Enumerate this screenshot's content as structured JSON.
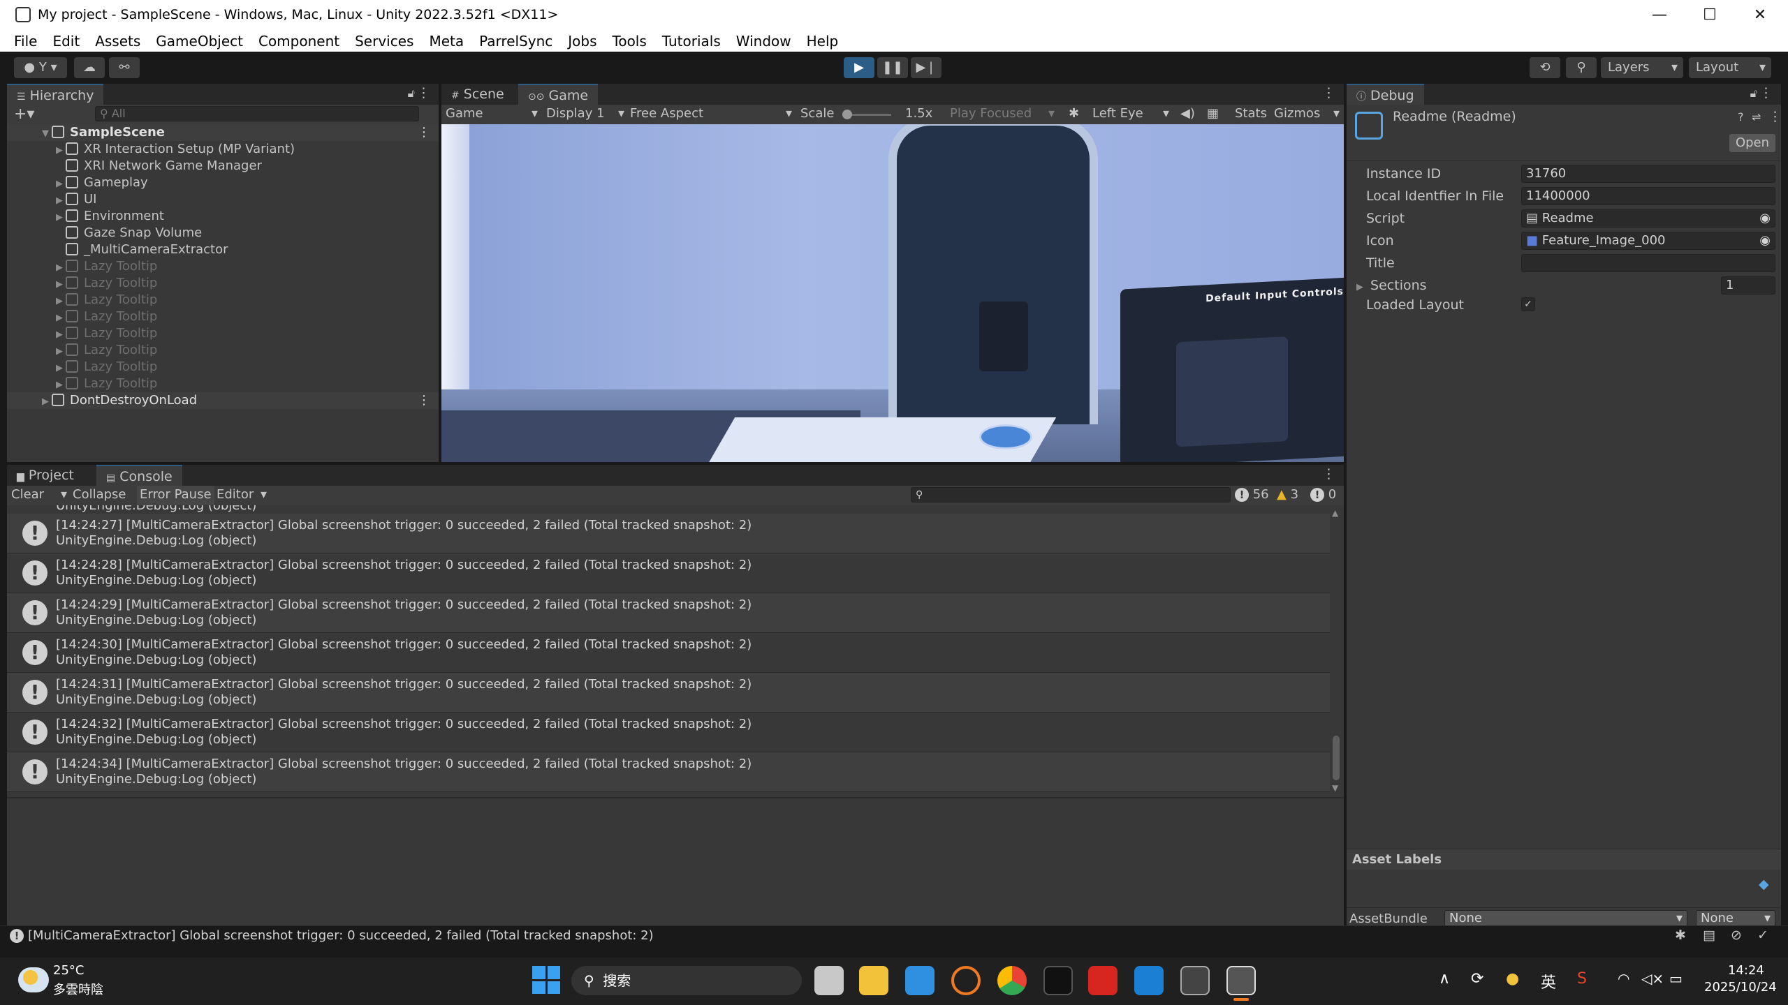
{
  "window": {
    "title": "My project - SampleScene - Windows, Mac, Linux - Unity 2022.3.52f1 <DX11>",
    "minimize": "—",
    "maximize": "☐",
    "close": "✕"
  },
  "menu": [
    "File",
    "Edit",
    "Assets",
    "GameObject",
    "Component",
    "Services",
    "Meta",
    "ParrelSync",
    "Jobs",
    "Tools",
    "Tutorials",
    "Window",
    "Help"
  ],
  "toolbar": {
    "account": "Y",
    "layers": "Layers",
    "layout": "Layout"
  },
  "hierarchy": {
    "tab": "Hierarchy",
    "search_placeholder": "All",
    "scene": "SampleScene",
    "items": [
      {
        "label": "XR Interaction Setup (MP Variant)",
        "expandable": true,
        "faded": false
      },
      {
        "label": "XRI Network Game Manager",
        "expandable": false,
        "faded": false
      },
      {
        "label": "Gameplay",
        "expandable": true,
        "faded": false
      },
      {
        "label": "UI",
        "expandable": true,
        "faded": false
      },
      {
        "label": "Environment",
        "expandable": true,
        "faded": false
      },
      {
        "label": "Gaze Snap Volume",
        "expandable": false,
        "faded": false
      },
      {
        "label": "_MultiCameraExtractor",
        "expandable": false,
        "faded": false
      },
      {
        "label": "Lazy Tooltip",
        "expandable": true,
        "faded": true
      },
      {
        "label": "Lazy Tooltip",
        "expandable": true,
        "faded": true
      },
      {
        "label": "Lazy Tooltip",
        "expandable": true,
        "faded": true
      },
      {
        "label": "Lazy Tooltip",
        "expandable": true,
        "faded": true
      },
      {
        "label": "Lazy Tooltip",
        "expandable": true,
        "faded": true
      },
      {
        "label": "Lazy Tooltip",
        "expandable": true,
        "faded": true
      },
      {
        "label": "Lazy Tooltip",
        "expandable": true,
        "faded": true
      },
      {
        "label": "Lazy Tooltip",
        "expandable": true,
        "faded": true
      }
    ],
    "dont_destroy": "DontDestroyOnLoad"
  },
  "game": {
    "tab_scene": "Scene",
    "tab_game": "Game",
    "mode": "Game",
    "display": "Display 1",
    "aspect": "Free Aspect",
    "scale_label": "Scale",
    "scale_value": "1.5x",
    "play_focused": "Play Focused",
    "eye": "Left Eye",
    "stats": "Stats",
    "gizmos": "Gizmos",
    "panel_title": "Default Input Controls"
  },
  "console": {
    "tab_project": "Project",
    "tab_console": "Console",
    "clear": "Clear",
    "collapse": "Collapse",
    "error_pause": "Error Pause",
    "editor": "Editor",
    "count_info": "56",
    "count_warn": "3",
    "count_error": "0",
    "partial_top": "UnityEngine.Debug:Log (object)",
    "logs": [
      {
        "line1": "[14:24:27] [MultiCameraExtractor] Global screenshot trigger: 0 succeeded, 2 failed (Total tracked snapshot: 2)",
        "line2": "UnityEngine.Debug:Log (object)"
      },
      {
        "line1": "[14:24:28] [MultiCameraExtractor] Global screenshot trigger: 0 succeeded, 2 failed (Total tracked snapshot: 2)",
        "line2": "UnityEngine.Debug:Log (object)"
      },
      {
        "line1": "[14:24:29] [MultiCameraExtractor] Global screenshot trigger: 0 succeeded, 2 failed (Total tracked snapshot: 2)",
        "line2": "UnityEngine.Debug:Log (object)"
      },
      {
        "line1": "[14:24:30] [MultiCameraExtractor] Global screenshot trigger: 0 succeeded, 2 failed (Total tracked snapshot: 2)",
        "line2": "UnityEngine.Debug:Log (object)"
      },
      {
        "line1": "[14:24:31] [MultiCameraExtractor] Global screenshot trigger: 0 succeeded, 2 failed (Total tracked snapshot: 2)",
        "line2": "UnityEngine.Debug:Log (object)"
      },
      {
        "line1": "[14:24:32] [MultiCameraExtractor] Global screenshot trigger: 0 succeeded, 2 failed (Total tracked snapshot: 2)",
        "line2": "UnityEngine.Debug:Log (object)"
      },
      {
        "line1": "[14:24:34] [MultiCameraExtractor] Global screenshot trigger: 0 succeeded, 2 failed (Total tracked snapshot: 2)",
        "line2": "UnityEngine.Debug:Log (object)"
      }
    ],
    "status": "[MultiCameraExtractor] Global screenshot trigger: 0 succeeded, 2 failed (Total tracked snapshot: 2)"
  },
  "inspector": {
    "tab": "Debug",
    "object_title": "Readme (Readme)",
    "open": "Open",
    "fields": {
      "instance_id_label": "Instance ID",
      "instance_id": "31760",
      "local_id_label": "Local Identfier In File",
      "local_id": "11400000",
      "script_label": "Script",
      "script": "Readme",
      "icon_label": "Icon",
      "icon": "Feature_Image_000",
      "title_label": "Title",
      "title": "",
      "sections_label": "Sections",
      "sections": "1",
      "loaded_layout_label": "Loaded Layout"
    },
    "asset_labels": "Asset Labels",
    "asset_bundle_label": "AssetBundle",
    "asset_bundle": "None",
    "asset_variant": "None"
  },
  "taskbar": {
    "temp": "25°C",
    "weather": "多雲時陰",
    "search": "搜索",
    "ime": "英",
    "time": "14:24",
    "date": "2025/10/24"
  }
}
